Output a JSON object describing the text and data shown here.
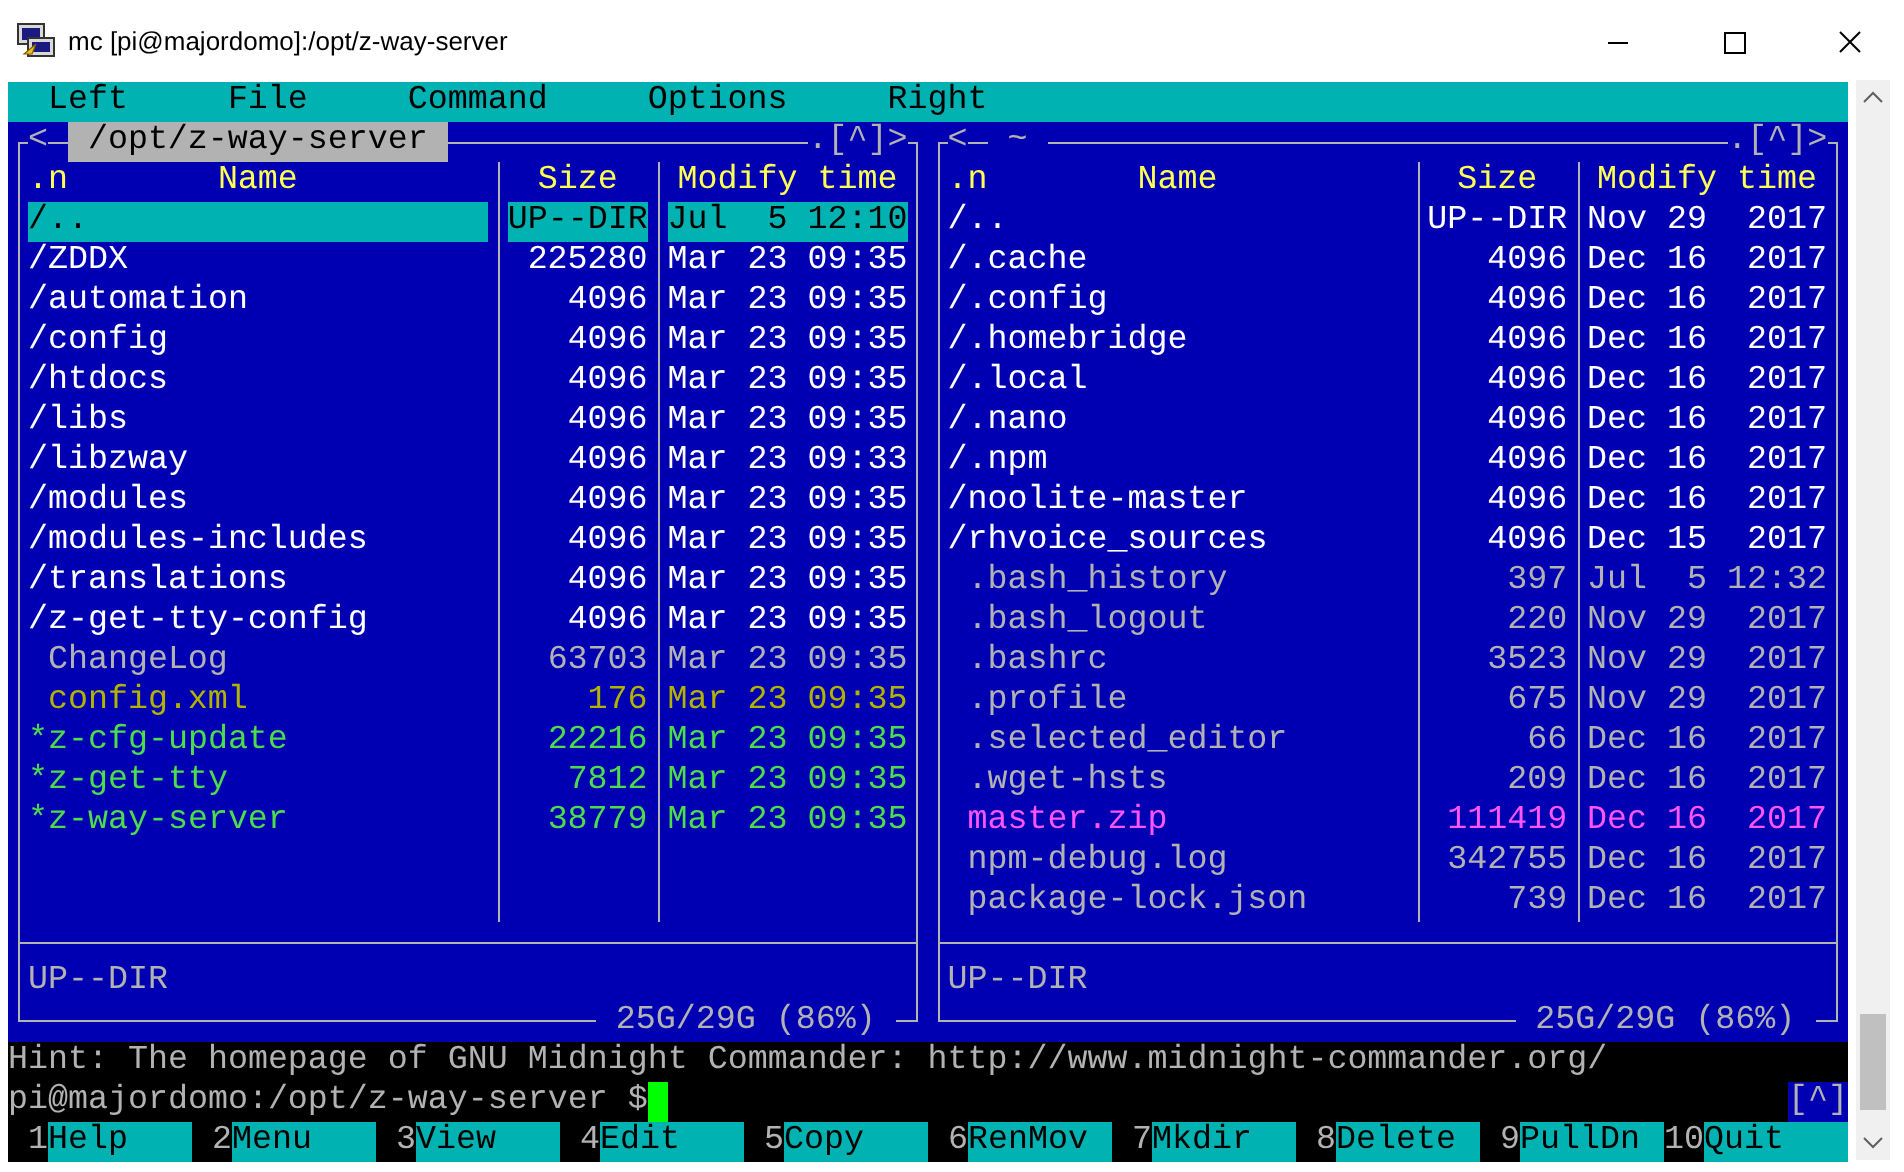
{
  "window": {
    "title": "mc [pi@majordomo]:/opt/z-way-server"
  },
  "menu": [
    {
      "label": "Left"
    },
    {
      "label": "File"
    },
    {
      "label": "Command"
    },
    {
      "label": "Options"
    },
    {
      "label": "Right"
    }
  ],
  "panels": [
    {
      "active": true,
      "prefix": "<",
      "path": "/opt/z-way-server",
      "suffix": ".[^]>",
      "columns": {
        "sort": ".n",
        "name": "Name",
        "size": "Size",
        "time": "Modify time"
      },
      "rows": [
        {
          "name": "/..",
          "size": "UP--DIR",
          "time": "Jul  5 12:10",
          "kind": "dir",
          "selected": true
        },
        {
          "name": "/ZDDX",
          "size": "225280",
          "time": "Mar 23 09:35",
          "kind": "dir",
          "selected": false
        },
        {
          "name": "/automation",
          "size": "4096",
          "time": "Mar 23 09:35",
          "kind": "dir",
          "selected": false
        },
        {
          "name": "/config",
          "size": "4096",
          "time": "Mar 23 09:35",
          "kind": "dir",
          "selected": false
        },
        {
          "name": "/htdocs",
          "size": "4096",
          "time": "Mar 23 09:35",
          "kind": "dir",
          "selected": false
        },
        {
          "name": "/libs",
          "size": "4096",
          "time": "Mar 23 09:35",
          "kind": "dir",
          "selected": false
        },
        {
          "name": "/libzway",
          "size": "4096",
          "time": "Mar 23 09:33",
          "kind": "dir",
          "selected": false
        },
        {
          "name": "/modules",
          "size": "4096",
          "time": "Mar 23 09:35",
          "kind": "dir",
          "selected": false
        },
        {
          "name": "/modules-includes",
          "size": "4096",
          "time": "Mar 23 09:35",
          "kind": "dir",
          "selected": false
        },
        {
          "name": "/translations",
          "size": "4096",
          "time": "Mar 23 09:35",
          "kind": "dir",
          "selected": false
        },
        {
          "name": "/z-get-tty-config",
          "size": "4096",
          "time": "Mar 23 09:35",
          "kind": "dir",
          "selected": false
        },
        {
          "name": "ChangeLog",
          "size": "63703",
          "time": "Mar 23 09:35",
          "kind": "file",
          "selected": false
        },
        {
          "name": "config.xml",
          "size": "176",
          "time": "Mar 23 09:35",
          "kind": "doc",
          "selected": false
        },
        {
          "name": "*z-cfg-update",
          "size": "22216",
          "time": "Mar 23 09:35",
          "kind": "exec",
          "selected": false
        },
        {
          "name": "*z-get-tty",
          "size": "7812",
          "time": "Mar 23 09:35",
          "kind": "exec",
          "selected": false
        },
        {
          "name": "*z-way-server",
          "size": "38779",
          "time": "Mar 23 09:35",
          "kind": "exec",
          "selected": false
        }
      ],
      "status": "UP--DIR",
      "disk": "25G/29G (86%)"
    },
    {
      "active": false,
      "prefix": "<",
      "path": "~",
      "suffix": ".[^]>",
      "columns": {
        "sort": ".n",
        "name": "Name",
        "size": "Size",
        "time": "Modify time"
      },
      "rows": [
        {
          "name": "/..",
          "size": "UP--DIR",
          "time": "Nov 29  2017",
          "kind": "dir",
          "selected": false
        },
        {
          "name": "/.cache",
          "size": "4096",
          "time": "Dec 16  2017",
          "kind": "dir",
          "selected": false
        },
        {
          "name": "/.config",
          "size": "4096",
          "time": "Dec 16  2017",
          "kind": "dir",
          "selected": false
        },
        {
          "name": "/.homebridge",
          "size": "4096",
          "time": "Dec 16  2017",
          "kind": "dir",
          "selected": false
        },
        {
          "name": "/.local",
          "size": "4096",
          "time": "Dec 16  2017",
          "kind": "dir",
          "selected": false
        },
        {
          "name": "/.nano",
          "size": "4096",
          "time": "Dec 16  2017",
          "kind": "dir",
          "selected": false
        },
        {
          "name": "/.npm",
          "size": "4096",
          "time": "Dec 16  2017",
          "kind": "dir",
          "selected": false
        },
        {
          "name": "/noolite-master",
          "size": "4096",
          "time": "Dec 16  2017",
          "kind": "dir",
          "selected": false
        },
        {
          "name": "/rhvoice_sources",
          "size": "4096",
          "time": "Dec 15  2017",
          "kind": "dir",
          "selected": false
        },
        {
          "name": ".bash_history",
          "size": "397",
          "time": "Jul  5 12:32",
          "kind": "file",
          "selected": false
        },
        {
          "name": ".bash_logout",
          "size": "220",
          "time": "Nov 29  2017",
          "kind": "file",
          "selected": false
        },
        {
          "name": ".bashrc",
          "size": "3523",
          "time": "Nov 29  2017",
          "kind": "file",
          "selected": false
        },
        {
          "name": ".profile",
          "size": "675",
          "time": "Nov 29  2017",
          "kind": "file",
          "selected": false
        },
        {
          "name": ".selected_editor",
          "size": "66",
          "time": "Dec 16  2017",
          "kind": "file",
          "selected": false
        },
        {
          "name": ".wget-hsts",
          "size": "209",
          "time": "Dec 16  2017",
          "kind": "file",
          "selected": false
        },
        {
          "name": "master.zip",
          "size": "111419",
          "time": "Dec 16  2017",
          "kind": "archive",
          "selected": false
        },
        {
          "name": "npm-debug.log",
          "size": "342755",
          "time": "Dec 16  2017",
          "kind": "file",
          "selected": false
        },
        {
          "name": "package-lock.json",
          "size": "739",
          "time": "Dec 16  2017",
          "kind": "file",
          "selected": false
        }
      ],
      "status": "UP--DIR",
      "disk": "25G/29G (86%)"
    }
  ],
  "hint": "Hint: The homepage of GNU Midnight Commander: http://www.midnight-commander.org/",
  "prompt": "pi@majordomo:/opt/z-way-server $",
  "history_button": "[^]",
  "function_keys": [
    {
      "num": "1",
      "label": "Help"
    },
    {
      "num": "2",
      "label": "Menu"
    },
    {
      "num": "3",
      "label": "View"
    },
    {
      "num": "4",
      "label": "Edit"
    },
    {
      "num": "5",
      "label": "Copy"
    },
    {
      "num": "6",
      "label": "RenMov"
    },
    {
      "num": "7",
      "label": "Mkdir"
    },
    {
      "num": "8",
      "label": "Delete"
    },
    {
      "num": "9",
      "label": "PullDn"
    },
    {
      "num": "10",
      "label": "Quit"
    }
  ]
}
